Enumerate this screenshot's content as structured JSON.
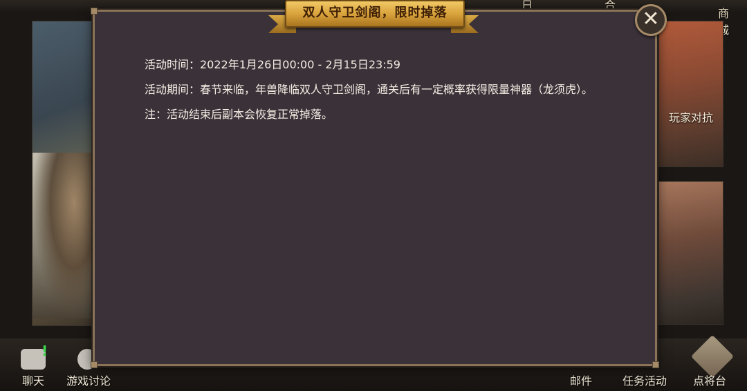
{
  "top_bar": {
    "items": [
      "日上",
      "合传",
      "商城"
    ]
  },
  "side_cards": {
    "right_card_label": "玩家对抗"
  },
  "modal": {
    "title": "双人守卫剑阁，限时掉落",
    "close_glyph": "✕",
    "lines": [
      "活动时间：2022年1月26日00:00 - 2月15日23:59",
      "活动期间：春节来临，年兽降临双人守卫剑阁，通关后有一定概率获得限量神器（龙须虎）。",
      "注：活动结束后副本会恢复正常掉落。"
    ]
  },
  "bottom_bar": {
    "chat_label": "聊天",
    "chat_badge": "!",
    "discussion_label": "游戏讨论",
    "mail_label": "邮件",
    "tasks_label": "任务活动",
    "general_label": "点将台"
  },
  "colors": {
    "modal_bg": "#3b3139",
    "modal_border": "#8a7358",
    "banner_gold": "#d9a33c",
    "text": "#f5efe5",
    "badge_green": "#39d84a"
  }
}
